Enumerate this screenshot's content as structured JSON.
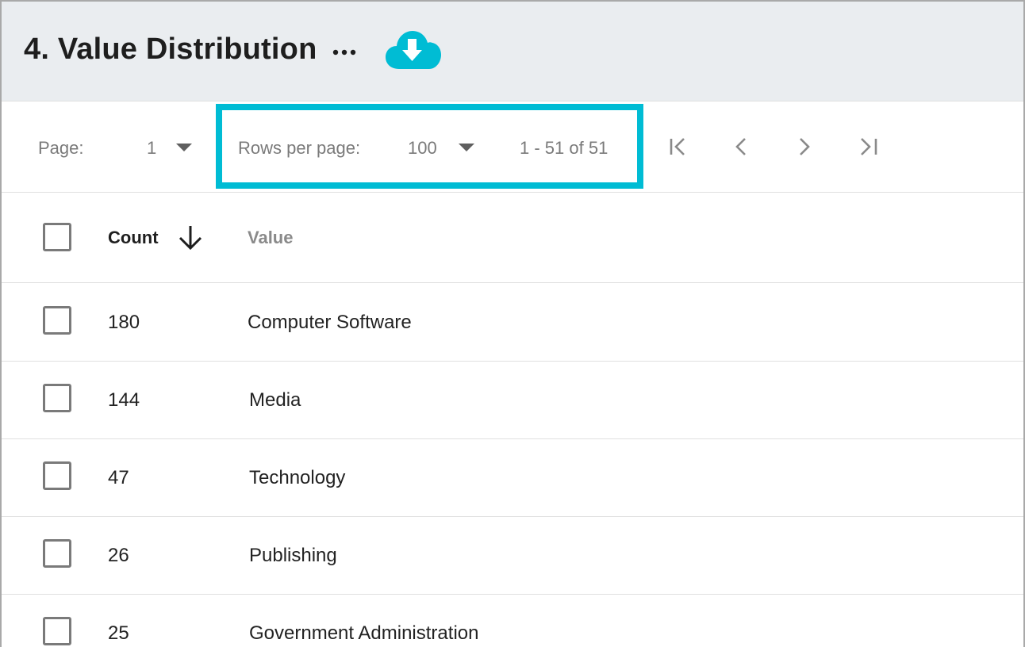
{
  "header": {
    "title": "4. Value Distribution",
    "more_icon": "more-horizontal-icon",
    "download_icon": "cloud-download-icon",
    "accent_color": "#00bcd4"
  },
  "pagination": {
    "page_label": "Page:",
    "page_value": "1",
    "rows_per_page_label": "Rows per page:",
    "rows_per_page_value": "100",
    "range_text": "1 - 51 of 51",
    "nav_icons": [
      "first-page-icon",
      "previous-page-icon",
      "next-page-icon",
      "last-page-icon"
    ]
  },
  "table": {
    "columns": [
      {
        "label": "Count",
        "sorted": "descending"
      },
      {
        "label": "Value"
      }
    ],
    "rows": [
      {
        "count": "180",
        "value": "Computer Software"
      },
      {
        "count": "144",
        "value": "Media"
      },
      {
        "count": "47",
        "value": "Technology"
      },
      {
        "count": "26",
        "value": "Publishing"
      },
      {
        "count": "25",
        "value": "Government Administration"
      }
    ]
  }
}
